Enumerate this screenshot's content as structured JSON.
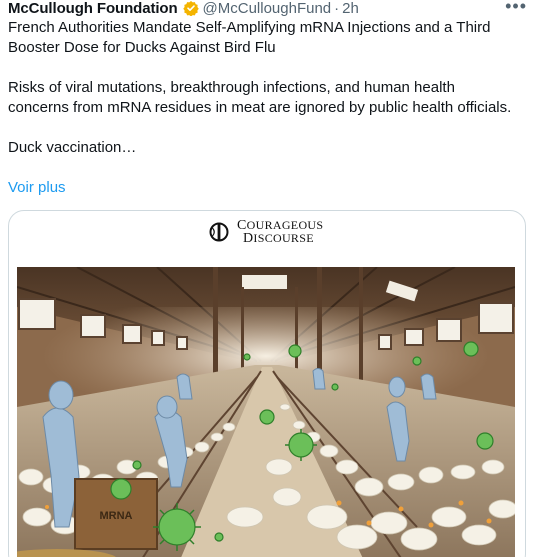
{
  "post": {
    "author_name": "McCullough Foundation",
    "verified_icon": "verified-badge-icon",
    "verified_color": "#f4b400",
    "handle": "@McCulloughFund",
    "separator": "·",
    "time": "2h",
    "more_icon": "•••",
    "text_line1": "French Authorities Mandate Self-Amplifying mRNA Injections and a Third Booster Dose for Ducks Against Bird Flu",
    "text_line2": "Risks of viral mutations, breakthrough infections, and human health concerns from mRNA residues in meat are ignored by public health officials.",
    "text_line3": "Duck vaccination…",
    "see_more": "Voir plus",
    "link_color": "#1d9bf0"
  },
  "media": {
    "logo_line1_cap": "C",
    "logo_line1_rest": "OURAGEOUS",
    "logo_line2_cap": "D",
    "logo_line2_rest": "ISCOURSE",
    "image_label": "MRNA"
  }
}
